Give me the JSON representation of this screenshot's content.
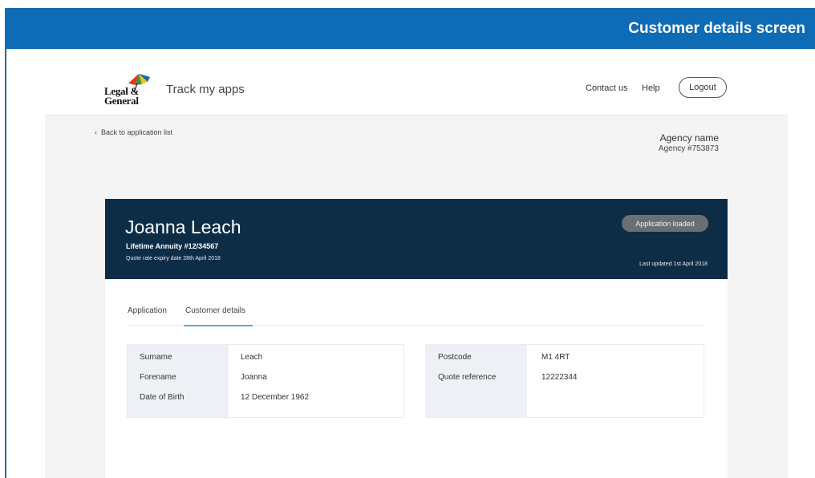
{
  "caption": "Customer details screen",
  "colors": {
    "caption_blue": "#0e6bb5",
    "hero_navy": "#0d2d47",
    "tab_accent": "#5aa7d9"
  },
  "header": {
    "brand_line1": "Legal &",
    "brand_line2": "General",
    "app_title": "Track my apps",
    "nav": {
      "contact": "Contact us",
      "help": "Help",
      "logout": "Logout"
    }
  },
  "back_link": "Back to application list",
  "agency": {
    "name": "Agency name",
    "number": "Agency #753873"
  },
  "hero": {
    "customer_name": "Joanna Leach",
    "product": "Lifetime Annuity  #12/34567",
    "quote_expiry": "Quote rate expiry date 28th April 2018",
    "status": "Application loaded",
    "last_updated": "Last updated 1st April 2018"
  },
  "tabs": [
    "Application",
    "Customer details"
  ],
  "active_tab": "Customer details",
  "details_left": [
    {
      "label": "Surname",
      "value": "Leach"
    },
    {
      "label": "Forename",
      "value": "Joanna"
    },
    {
      "label": "Date of Birth",
      "value": "12 December 1962"
    }
  ],
  "details_right": [
    {
      "label": "Postcode",
      "value": "M1 4RT"
    },
    {
      "label": "Quote reference",
      "value": "12222344"
    }
  ]
}
